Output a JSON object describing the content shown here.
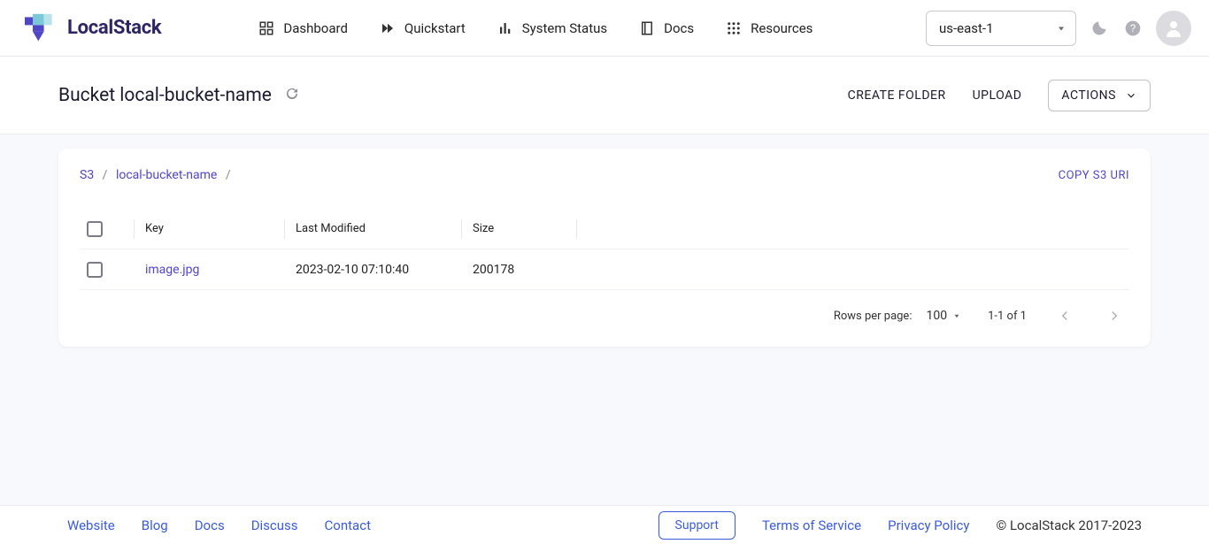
{
  "brand": {
    "name": "LocalStack"
  },
  "nav": {
    "dashboard": "Dashboard",
    "quickstart": "Quickstart",
    "system_status": "System Status",
    "docs": "Docs",
    "resources": "Resources"
  },
  "region": {
    "selected": "us-east-1"
  },
  "page": {
    "title": "Bucket local-bucket-name",
    "create_folder": "CREATE FOLDER",
    "upload": "UPLOAD",
    "actions": "ACTIONS"
  },
  "breadcrumbs": {
    "root": "S3",
    "bucket": "local-bucket-name"
  },
  "copy_uri": "COPY S3 URI",
  "table": {
    "headers": {
      "key": "Key",
      "last_modified": "Last Modified",
      "size": "Size"
    },
    "rows": [
      {
        "key": "image.jpg",
        "last_modified": "2023-02-10 07:10:40",
        "size": "200178"
      }
    ]
  },
  "pagination": {
    "label": "Rows per page:",
    "per_page": "100",
    "range": "1-1 of 1"
  },
  "footer": {
    "website": "Website",
    "blog": "Blog",
    "docs": "Docs",
    "discuss": "Discuss",
    "contact": "Contact",
    "support": "Support",
    "terms": "Terms of Service",
    "privacy": "Privacy Policy",
    "copyright": "© LocalStack 2017-2023"
  }
}
